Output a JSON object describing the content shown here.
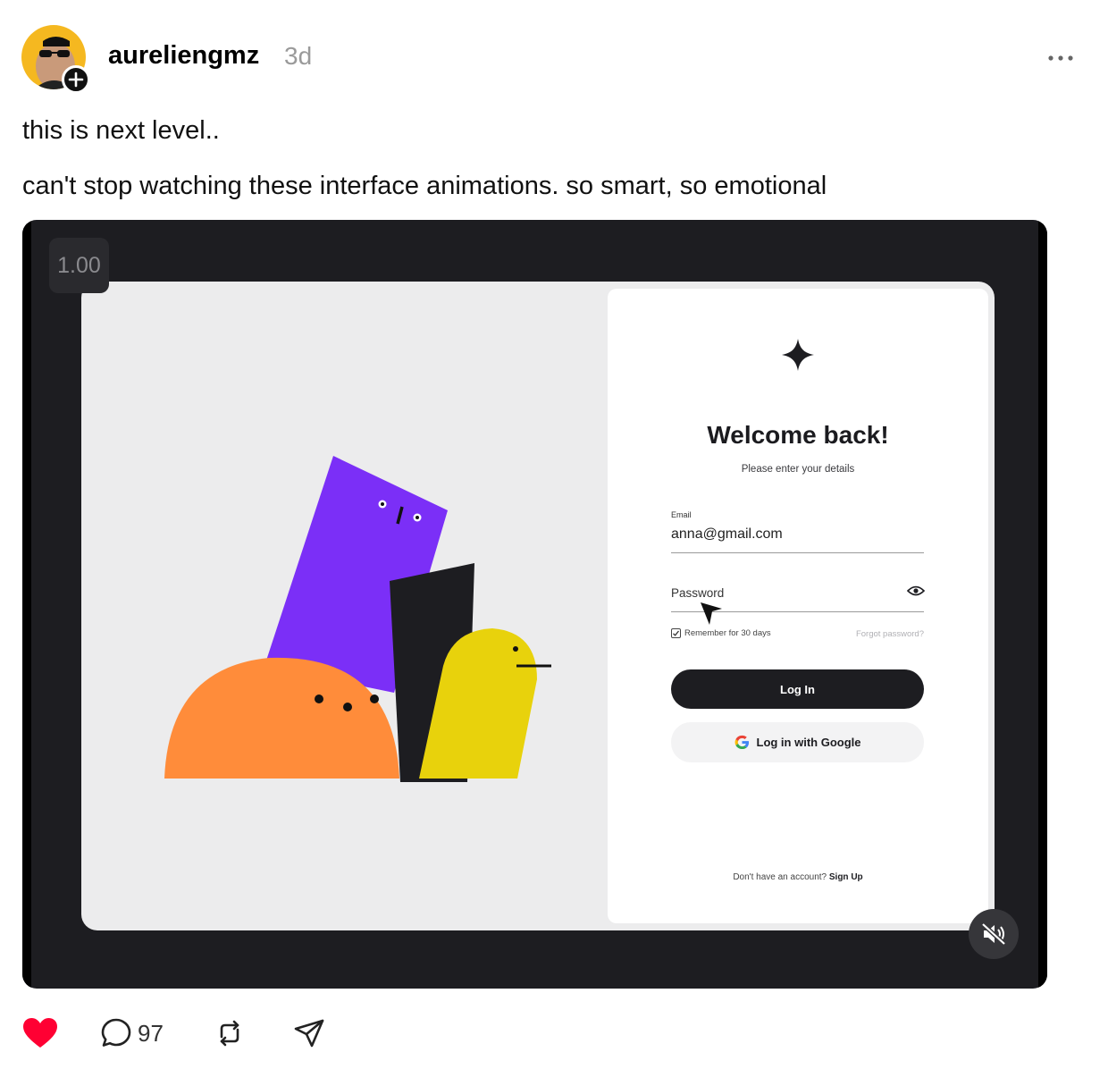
{
  "post": {
    "username": "aureliengmz",
    "timestamp": "3d",
    "text_line1": "this is next level..",
    "text_line2": "can't stop watching these interface animations. so smart, so emotional"
  },
  "video": {
    "zoom_label": "1.00",
    "muted": true,
    "login_screen": {
      "title": "Welcome back!",
      "subtitle": "Please enter your details",
      "email_label": "Email",
      "email_value": "anna@gmail.com",
      "password_label": "Password",
      "remember_label": "Remember for 30 days",
      "remember_checked": true,
      "forgot_label": "Forgot password?",
      "login_button": "Log In",
      "google_button": "Log in with Google",
      "signup_prompt": "Don't have an account?",
      "signup_link": "Sign Up"
    }
  },
  "actions": {
    "liked": true,
    "reply_count": "97"
  },
  "colors": {
    "like_red": "#ff0033",
    "purple": "#7b2ff7",
    "orange": "#ff8c3a",
    "yellow": "#e8d20c",
    "dark": "#1d1d21"
  },
  "icons": [
    "avatar",
    "plus-icon",
    "more-icon",
    "sparkle-logo-icon",
    "eye-icon",
    "cursor-icon",
    "check-icon",
    "google-icon",
    "mute-icon",
    "heart-icon",
    "reply-icon",
    "repost-icon",
    "share-icon"
  ]
}
